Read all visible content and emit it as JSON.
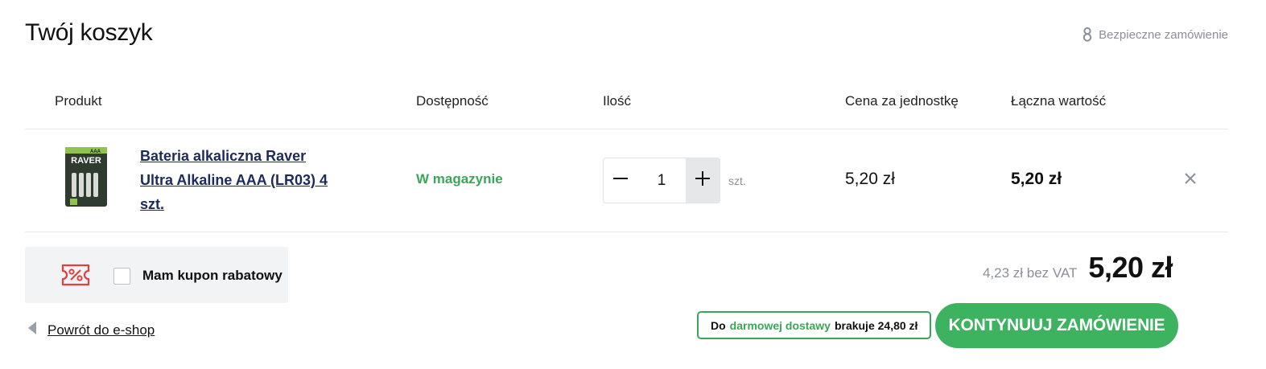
{
  "page": {
    "title": "Twój koszyk",
    "secure_label": "Bezpieczne zamówienie"
  },
  "table": {
    "headers": {
      "product": "Produkt",
      "availability": "Dostępność",
      "quantity": "Ilość",
      "unit_price": "Cena za jednostkę",
      "total": "Łączna wartość"
    },
    "items": [
      {
        "name": "Bateria alkaliczna Raver Ultra Alkaline AAA (LR03) 4 szt.",
        "availability": "W magazynie",
        "quantity": "1",
        "unit": "szt.",
        "unit_price": "5,20 zł",
        "total": "5,20 zł",
        "image_brand": "RAVER",
        "image_text": "AAA"
      }
    ]
  },
  "coupon": {
    "label": "Mam kupon rabatowy",
    "checked": false
  },
  "back": {
    "label": "Powrót do e-shop"
  },
  "summary": {
    "net": "4,23 zł bez VAT",
    "total": "5,20 zł"
  },
  "shipping": {
    "prefix": "Do",
    "highlight": "darmowej dostawy",
    "suffix": "brakuje 24,80 zł"
  },
  "cta": {
    "label": "KONTYNUUJ ZAMÓWIENIE"
  },
  "colors": {
    "accent_green": "#3db35f",
    "stock_green": "#3aa757",
    "coupon_red": "#e2403f",
    "link_navy": "#1c2b5a"
  }
}
